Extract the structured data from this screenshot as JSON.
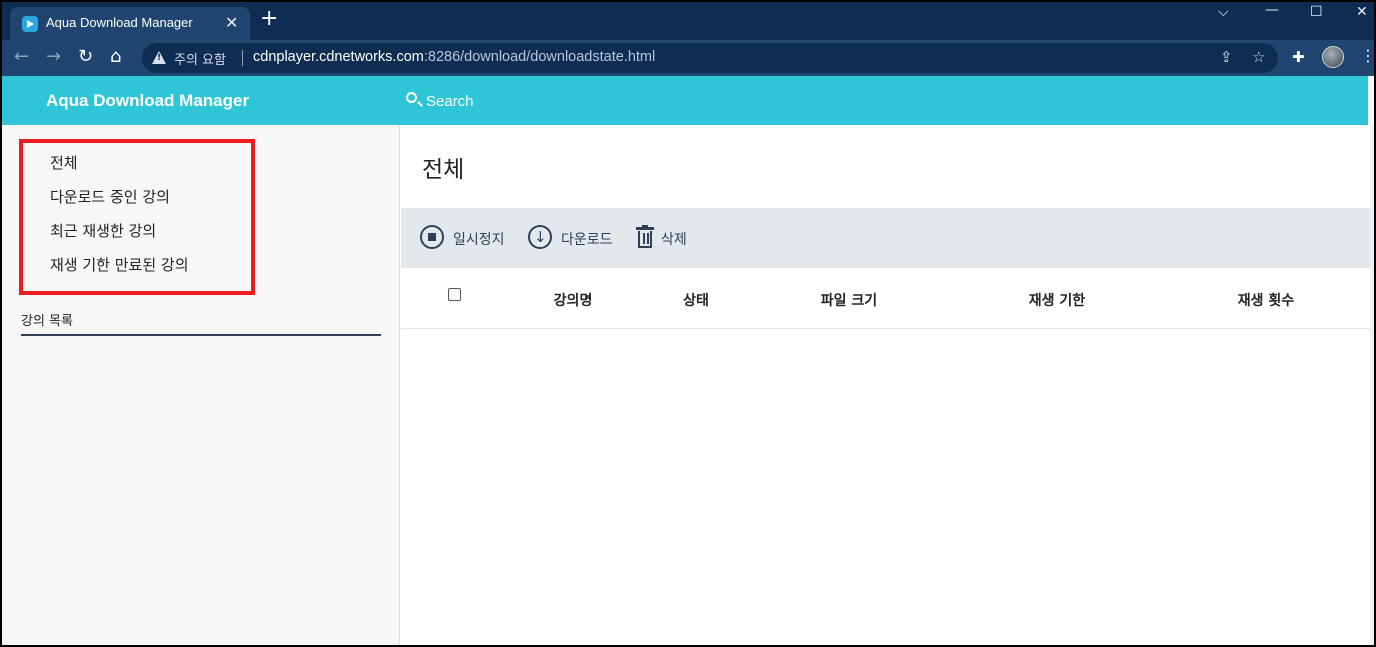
{
  "browser": {
    "tab_title": "Aqua Download Manager",
    "security_warning": "주의 요함",
    "url_host": "cdnplayer.cdnetworks.com",
    "url_rest": ":8286/download/downloadstate.html"
  },
  "app": {
    "title": "Aqua Download Manager",
    "search_placeholder": "Search"
  },
  "sidebar": {
    "items": [
      {
        "label": "전체"
      },
      {
        "label": "다운로드 중인 강의"
      },
      {
        "label": "최근 재생한 강의"
      },
      {
        "label": "재생 기한 만료된 강의"
      }
    ],
    "section_title": "강의 목록"
  },
  "main": {
    "title": "전체",
    "actions": {
      "pause": "일시정지",
      "download": "다운로드",
      "delete": "삭제"
    },
    "columns": [
      "강의명",
      "상태",
      "파일 크기",
      "재생 기한",
      "재생 횟수"
    ]
  },
  "colors": {
    "header_accent": "#2ec6d6",
    "highlight_box": "#ee1c1c",
    "action_bar": "#e3e8ec"
  }
}
